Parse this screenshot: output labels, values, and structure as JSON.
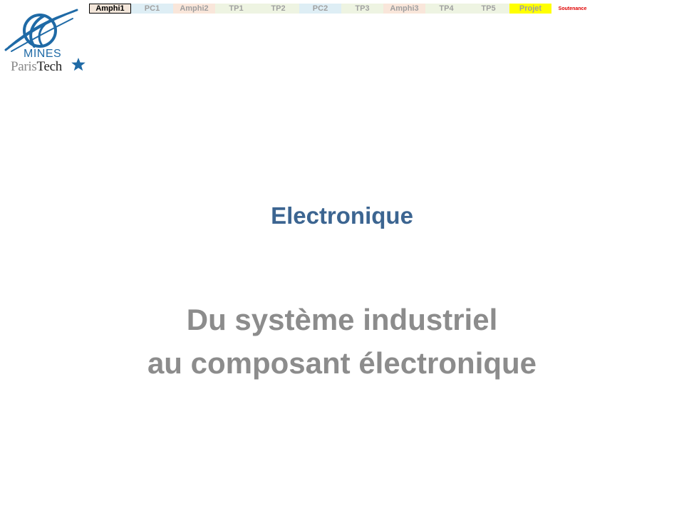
{
  "logo": {
    "line1": "MINES",
    "line2a": "Paris",
    "line2b": "Tech",
    "icon": "mines-paristech-emblem-icon",
    "star_icon": "star-icon",
    "colors": {
      "blue": "#1f6aa6",
      "grey": "#8a8a8a",
      "dark": "#222222"
    }
  },
  "tabs": [
    {
      "label": "Amphi1",
      "bg": "#f3e6da",
      "color": "#000000",
      "active": true
    },
    {
      "label": "PC1",
      "bg": "#deeef5",
      "color": "#a0a0a0",
      "active": false
    },
    {
      "label": "Amphi2",
      "bg": "#f9e6da",
      "color": "#a0a0a0",
      "active": false
    },
    {
      "label": "TP1",
      "bg": "#eef4e2",
      "color": "#a0a0a0",
      "active": false
    },
    {
      "label": "TP2",
      "bg": "#eef4e2",
      "color": "#a0a0a0",
      "active": false
    },
    {
      "label": "PC2",
      "bg": "#deeef5",
      "color": "#a0a0a0",
      "active": false
    },
    {
      "label": "TP3",
      "bg": "#eef4e2",
      "color": "#a0a0a0",
      "active": false
    },
    {
      "label": "Amphi3",
      "bg": "#f9e6da",
      "color": "#a0a0a0",
      "active": false
    },
    {
      "label": "TP4",
      "bg": "#eef4e2",
      "color": "#a0a0a0",
      "active": false
    },
    {
      "label": "TP5",
      "bg": "#eef4e2",
      "color": "#a0a0a0",
      "active": false
    },
    {
      "label": "Projet",
      "bg": "#ffff00",
      "color": "#a0a0a0",
      "active": false
    },
    {
      "label": "Soutenance",
      "bg": "#ffffff",
      "color": "#e00000",
      "active": false,
      "small": true
    }
  ],
  "slide": {
    "title": "Electronique",
    "subtitle_line1": "Du système industriel",
    "subtitle_line2": "au composant électronique",
    "title_color": "#3c6591",
    "subtitle_color": "#8c8c8c"
  }
}
